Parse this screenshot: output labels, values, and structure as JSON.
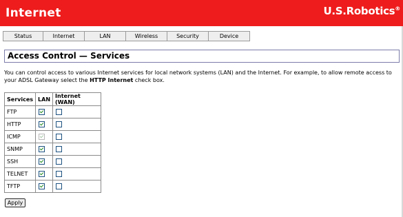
{
  "header": {
    "title": "Internet",
    "brand": "U.S.Robotics",
    "brand_mark": "®"
  },
  "tabs": [
    "Status",
    "Internet",
    "LAN",
    "Wireless",
    "Security",
    "Device"
  ],
  "page_title": "Access Control — Services",
  "description": {
    "pre": "You can control access to various Internet services for local network systems (LAN) and the Internet. For example, to allow remote access to your ADSL Gateway select the ",
    "bold": "HTTP Internet",
    "post": " check box."
  },
  "table": {
    "headers": [
      "Services",
      "LAN",
      "Internet (WAN)"
    ],
    "rows": [
      {
        "service": "FTP",
        "lan": true,
        "lan_enabled": true,
        "wan": false
      },
      {
        "service": "HTTP",
        "lan": true,
        "lan_enabled": true,
        "wan": false
      },
      {
        "service": "ICMP",
        "lan": true,
        "lan_enabled": false,
        "wan": false
      },
      {
        "service": "SNMP",
        "lan": true,
        "lan_enabled": true,
        "wan": false
      },
      {
        "service": "SSH",
        "lan": true,
        "lan_enabled": true,
        "wan": false
      },
      {
        "service": "TELNET",
        "lan": true,
        "lan_enabled": true,
        "wan": false
      },
      {
        "service": "TFTP",
        "lan": true,
        "lan_enabled": true,
        "wan": false
      }
    ]
  },
  "apply_label": "Apply",
  "colors": {
    "header_bg": "#ee1c1c",
    "check": "#1e8a1e"
  }
}
